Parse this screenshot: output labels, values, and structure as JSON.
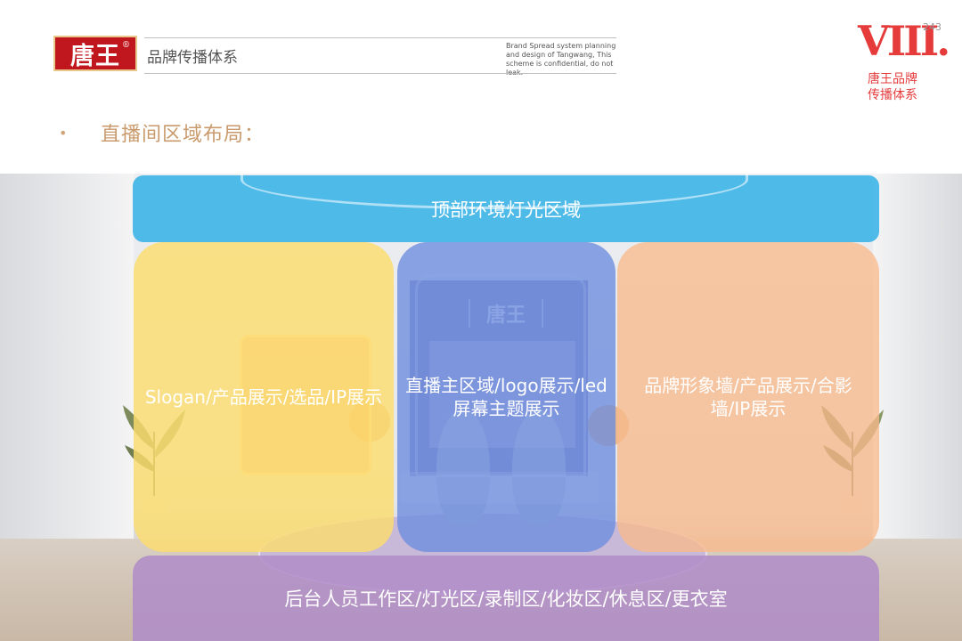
{
  "header": {
    "logo_text": "唐王",
    "logo_reg": "®",
    "title": "品牌传播体系",
    "description": "Brand Spread system planning and design of Tangwang, This scheme is confidential, do not leak.",
    "chapter_number": "VIII.",
    "chapter_name": "唐王品牌传播体系",
    "page_number": "243"
  },
  "section": {
    "bullet": "•",
    "title": "直播间区域布局："
  },
  "scene": {
    "brand_mark": "唐王"
  },
  "zones": {
    "top": "顶部环境灯光区域",
    "left": "Slogan/产品展示/选品/IP展示",
    "center": "直播主区域/logo展示/led屏幕主题展示",
    "right": "品牌形象墙/产品展示/合影墙/IP展示",
    "bottom": "后台人员工作区/灯光区/录制区/化妆区/休息区/更衣室"
  },
  "colors": {
    "brand_red": "#c0161d",
    "chapter_red": "#e53b3b",
    "section_title": "#c99a6c",
    "zone_top": "#33b0e6",
    "zone_left": "#fcdd6e",
    "zone_center": "#6c8cde",
    "zone_right": "#f8ba8c",
    "zone_bottom": "#af8cc8"
  }
}
